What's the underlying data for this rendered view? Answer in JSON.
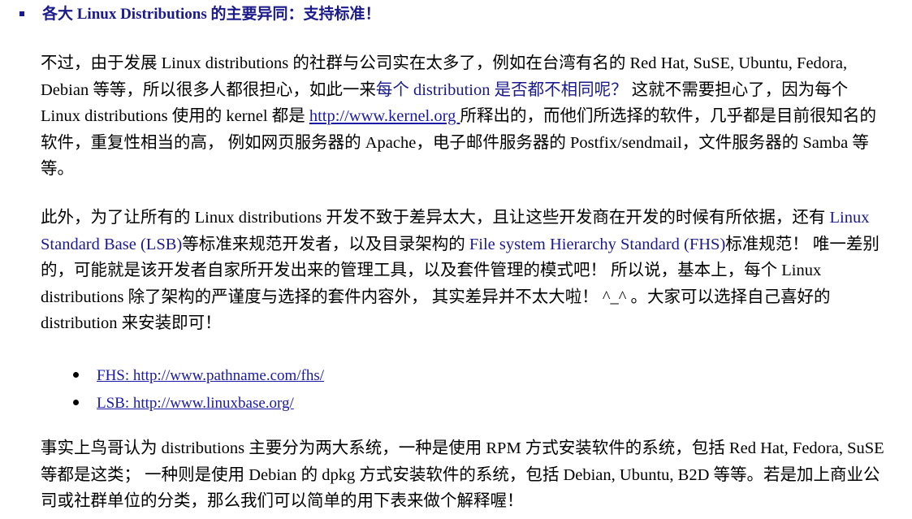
{
  "heading": "各大 Linux Distributions 的主要异同：支持标准！",
  "paragraph1": {
    "part1": "不过，由于发展 Linux distributions 的社群与公司实在太多了，例如在台湾有名的 Red Hat, SuSE, Ubuntu, Fedora, Debian 等等，所以很多人都很担心，如此一来",
    "highlight": "每个 distribution 是否都不相同呢？",
    "part2": " 这就不需要担心了，因为每个 Linux distributions 使用的 kernel 都是 ",
    "link": "http://www.kernel.org ",
    "part3": "所释出的，而他们所选择的软件，几乎都是目前很知名的软件，重复性相当的高，  例如网页服务器的 Apache，电子邮件服务器的 Postfix/sendmail，文件服务器的 Samba 等等。"
  },
  "paragraph2": {
    "part1": "此外，为了让所有的 Linux distributions 开发不致于差异太大，且让这些开发商在开发的时候有所依据，还有 ",
    "lsb": "Linux Standard Base (LSB)",
    "part2": "等标准来规范开发者，以及目录架构的 ",
    "fhs": "File system Hierarchy Standard (FHS)",
    "part3": "标准规范！  唯一差别的，可能就是该开发者自家所开发出来的管理工具，以及套件管理的模式吧！  所以说，基本上，每个 Linux distributions 除了架构的严谨度与选择的套件内容外，  其实差异并不太大啦！  ^_^  。大家可以选择自己喜好的 distribution 来安装即可！"
  },
  "links": [
    {
      "label": "FHS: http://www.pathname.com/fhs/"
    },
    {
      "label": "LSB: http://www.linuxbase.org/"
    }
  ],
  "paragraph3": "事实上鸟哥认为 distributions 主要分为两大系统，一种是使用 RPM 方式安装软件的系统，包括 Red Hat, Fedora, SuSE 等都是这类；  一种则是使用 Debian 的 dpkg 方式安装软件的系统，包括 Debian, Ubuntu, B2D 等等。若是加上商业公司或社群单位的分类，那么我们可以简单的用下表来做个解释喔！",
  "colors": {
    "heading": "#1a1a8c",
    "link": "#1a1aa6",
    "highlight": "#1a1a8c"
  }
}
